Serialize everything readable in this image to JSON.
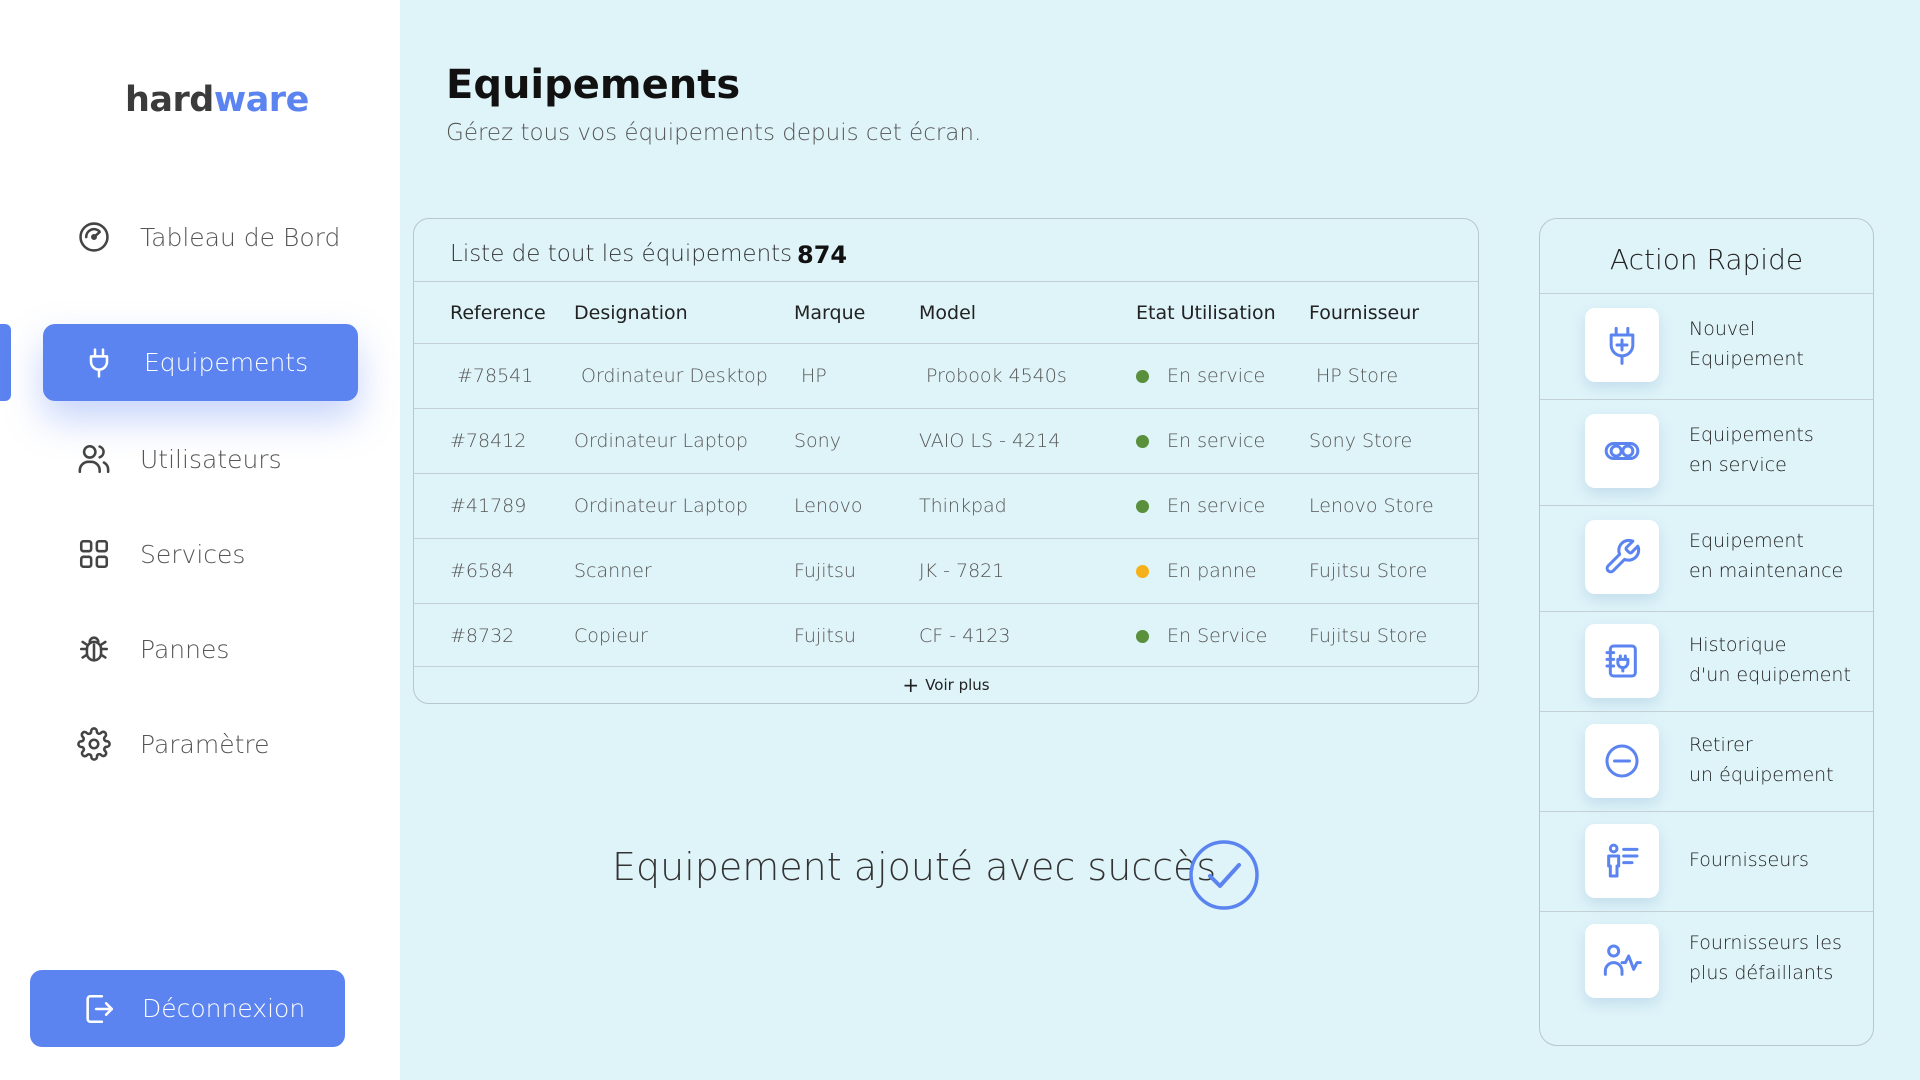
{
  "brand": {
    "part1": "hard",
    "part2": "ware"
  },
  "nav": {
    "items": [
      {
        "id": "dashboard",
        "label": "Tableau de Bord",
        "icon": "gauge-icon"
      },
      {
        "id": "equipements",
        "label": "Equipements",
        "icon": "plug-icon",
        "active": true
      },
      {
        "id": "users",
        "label": "Utilisateurs",
        "icon": "users-icon"
      },
      {
        "id": "services",
        "label": "Services",
        "icon": "grid-icon"
      },
      {
        "id": "pannes",
        "label": "Pannes",
        "icon": "bug-icon"
      },
      {
        "id": "parametre",
        "label": "Paramètre",
        "icon": "gear-icon"
      }
    ],
    "logout": "Déconnexion"
  },
  "header": {
    "title": "Equipements",
    "subtitle": "Gérez tous vos équipements depuis cet écran."
  },
  "table": {
    "caption": "Liste de tout les équipements :",
    "count": "874",
    "columns": [
      "Reference",
      "Designation",
      "Marque",
      "Model",
      "Etat Utilisation",
      "Fournisseur"
    ],
    "rows": [
      {
        "ref": "#78541",
        "designation": "Ordinateur Desktop",
        "marque": "HP",
        "model": "Probook 4540s",
        "etat": "En service",
        "status_color": "#5a8f3c",
        "fournisseur": "HP Store"
      },
      {
        "ref": "#78412",
        "designation": "Ordinateur Laptop",
        "marque": "Sony",
        "model": "VAIO LS - 4214",
        "etat": "En service",
        "status_color": "#5a8f3c",
        "fournisseur": "Sony Store"
      },
      {
        "ref": "#41789",
        "designation": "Ordinateur Laptop",
        "marque": "Lenovo",
        "model": "Thinkpad",
        "etat": "En service",
        "status_color": "#5a8f3c",
        "fournisseur": "Lenovo Store"
      },
      {
        "ref": "#6584",
        "designation": "Scanner",
        "marque": "Fujitsu",
        "model": "JK - 7821",
        "etat": "En panne",
        "status_color": "#f6b11a",
        "fournisseur": "Fujitsu Store"
      },
      {
        "ref": "#8732",
        "designation": "Copieur",
        "marque": "Fujitsu",
        "model": "CF - 4123",
        "etat": "En Service",
        "status_color": "#5a8f3c",
        "fournisseur": "Fujitsu Store"
      }
    ],
    "more": "Voir plus"
  },
  "notification": {
    "message": "Equipement ajouté avec succès"
  },
  "quick_actions": {
    "title": "Action Rapide",
    "items": [
      {
        "line1": "Nouvel",
        "line2": "Equipement",
        "icon": "plug-plus-icon"
      },
      {
        "line1": "Equipements",
        "line2": "en service",
        "icon": "toggle-icon"
      },
      {
        "line1": "Equipement",
        "line2": "en maintenance",
        "icon": "wrench-icon"
      },
      {
        "line1": "Historique",
        "line2": "d'un equipement",
        "icon": "history-notebook-icon"
      },
      {
        "line1": "Retirer",
        "line2": "un équipement",
        "icon": "minus-circle-icon"
      },
      {
        "line1": "Fournisseurs",
        "line2": "",
        "icon": "supplier-list-icon"
      },
      {
        "line1": "Fournisseurs les",
        "line2": "plus défaillants",
        "icon": "supplier-activity-icon"
      }
    ]
  },
  "colors": {
    "accent": "#5b84f0",
    "background": "#dff4f9",
    "ok": "#5a8f3c",
    "warning": "#f6b11a"
  }
}
